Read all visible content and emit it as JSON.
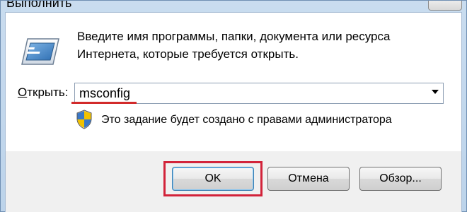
{
  "window": {
    "title": "Выполнить",
    "close_icon": "close-icon"
  },
  "dialog": {
    "description": "Введите имя программы, папки, документа или ресурса Интернета, которые требуется открыть.",
    "open_label_prefix": "О",
    "open_label_rest": "ткрыть:",
    "command_value": "msconfig",
    "admin_note": "Это задание будет создано с правами администратора"
  },
  "buttons": {
    "ok": "OK",
    "cancel": "Отмена",
    "browse": "Обзор..."
  },
  "colors": {
    "highlight": "#d2233a",
    "underline": "#d22a2a"
  }
}
